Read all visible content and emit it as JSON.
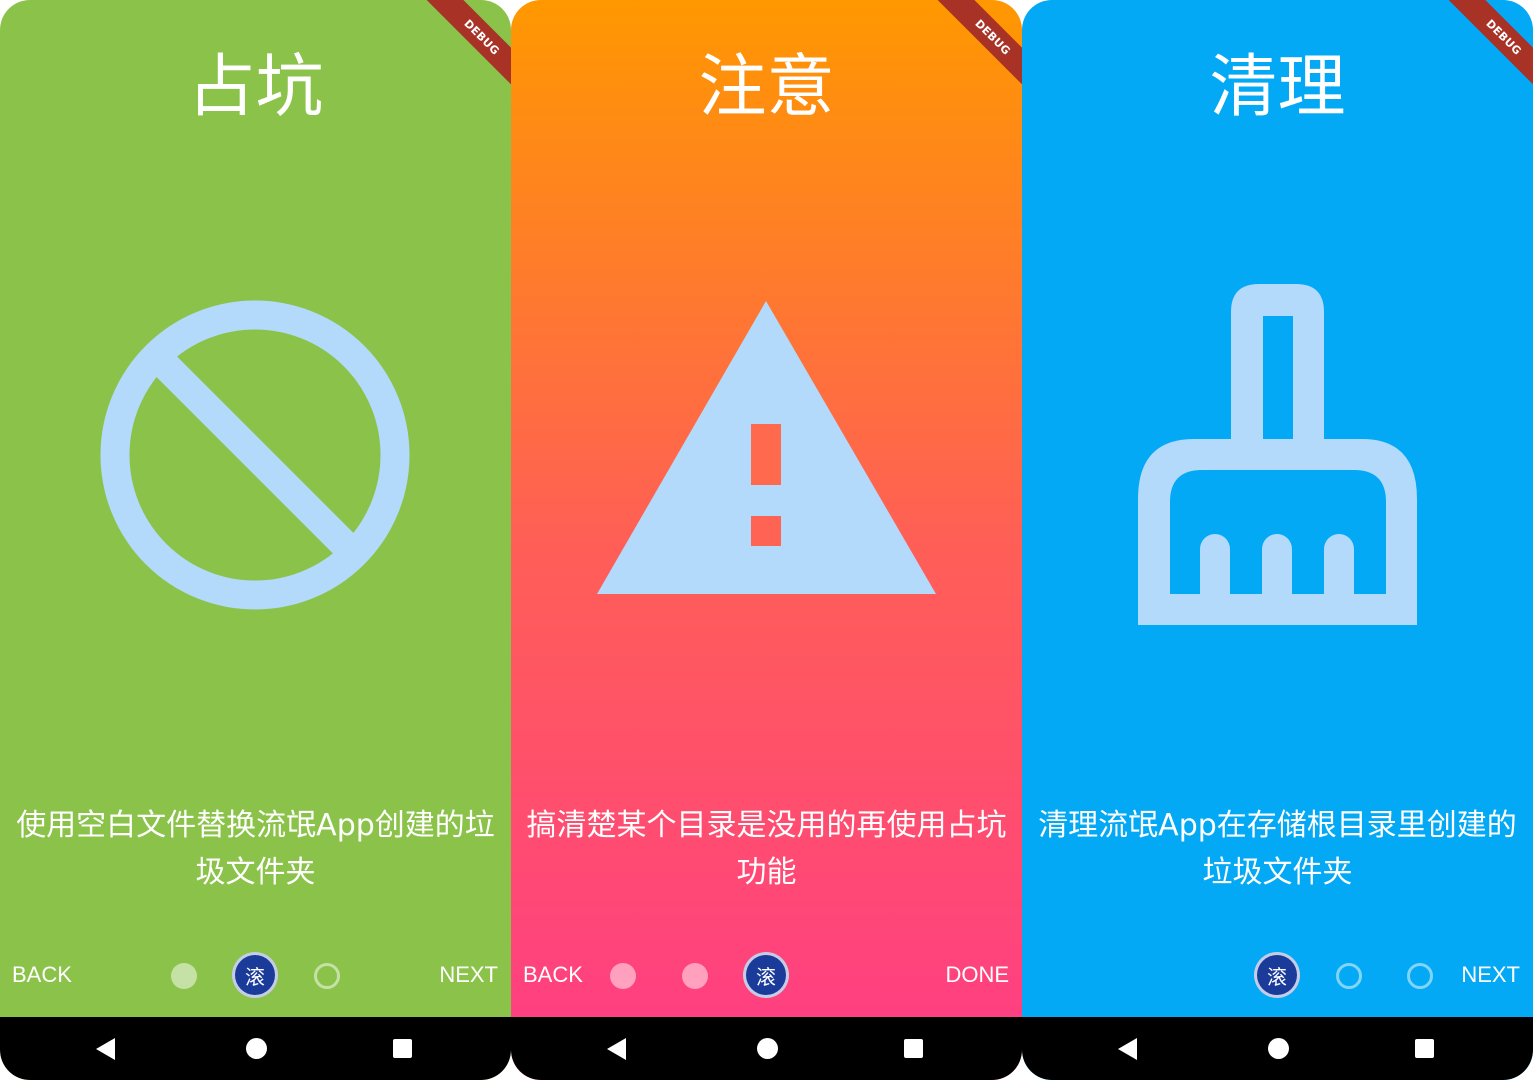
{
  "debug_banner": "DEBUG",
  "screens": [
    {
      "title": "占坑",
      "description": "使用空白文件替换流氓App创建的垃圾文件夹",
      "back_label": "BACK",
      "forward_label": "NEXT",
      "current_indicator": "滚",
      "illustration": "block-icon",
      "background": "#8bc34a",
      "page_index": 2,
      "page_count": 3
    },
    {
      "title": "注意",
      "description": "搞清楚某个目录是没用的再使用占坑功能",
      "back_label": "BACK",
      "forward_label": "DONE",
      "current_indicator": "滚",
      "illustration": "warning-icon",
      "background": "#ff9800",
      "page_index": 3,
      "page_count": 3
    },
    {
      "title": "清理",
      "description": "清理流氓App在存储根目录里创建的垃圾文件夹",
      "back_label": "",
      "forward_label": "NEXT",
      "current_indicator": "滚",
      "illustration": "cleaning-brush-icon",
      "background": "#03a9f4",
      "page_index": 1,
      "page_count": 3
    }
  ],
  "colors": {
    "icon_tint": "#b3d9fb",
    "indicator": "#1b3b9b",
    "debug_banner": "#a93226"
  }
}
